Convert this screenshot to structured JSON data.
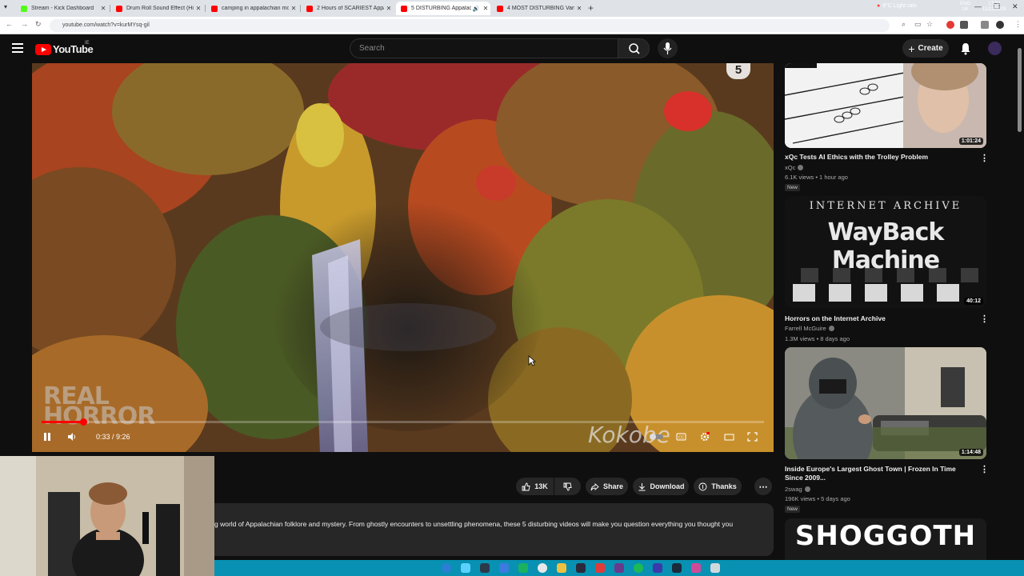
{
  "browser": {
    "tabs": [
      {
        "label": "Stream - Kick Dashboard",
        "favicon_color": "#53fc18",
        "active": false
      },
      {
        "label": "Drum Roll Sound Effect (High Q",
        "favicon_color": "#ff0000",
        "active": false
      },
      {
        "label": "camping in appalachian mount",
        "favicon_color": "#ff0000",
        "active": false
      },
      {
        "label": "2 Hours of SCARIEST Appalachi",
        "favicon_color": "#ff0000",
        "active": false
      },
      {
        "label": "5 DISTURBING Appalachian",
        "favicon_color": "#ff0000",
        "active": true
      },
      {
        "label": "4 MOST DISTURBING Van Cam",
        "favicon_color": "#ff0000",
        "active": false
      }
    ],
    "url": "youtube.com/watch?v=kurMYsq-gil"
  },
  "header": {
    "logo_text": "YouTube",
    "country_code": "IE",
    "search_placeholder": "Search",
    "create_label": "Create"
  },
  "player": {
    "current_time": "0:33",
    "duration": "9:26",
    "timecode": "0:33 / 9:26",
    "progress_fraction": 0.058,
    "watermark_left_line1": "REAL",
    "watermark_left_line2": "HORROR",
    "watermark_right": "Kokobe",
    "corner_number": "5"
  },
  "actions": {
    "likes": "13K",
    "share": "Share",
    "download": "Download",
    "thanks": "Thanks"
  },
  "description": {
    "text": "g world of Appalachian folklore and mystery. From ghostly encounters to unsettling phenomena, these 5 disturbing videos will make you question everything you thought you"
  },
  "recommendations": [
    {
      "title": "xQc Tests AI Ethics with the Trolley Problem",
      "channel": "xQc",
      "meta": "6.1K views • 1 hour ago",
      "duration": "1:01:24",
      "badge": "New"
    },
    {
      "title": "Horrors on the Internet Archive",
      "channel": "Farrell McGuire",
      "meta": "1.3M views • 8 days ago",
      "duration": "40:12",
      "badge": "",
      "thumb_line1": "INTERNET ARCHIVE",
      "thumb_line2": "WayBack Machine"
    },
    {
      "title": "Inside Europe's Largest Ghost Town | Frozen In Time Since 2009...",
      "channel": "2swag",
      "meta": "196K views • 5 days ago",
      "duration": "1:14:48",
      "badge": "New"
    },
    {
      "thumb_text": "SHOGGOTH"
    }
  ],
  "taskbar": {
    "weather": "8°C  Light rain",
    "lang1": "ENG",
    "lang2": "UK",
    "time": "17:52",
    "date": "11/12/2025"
  }
}
